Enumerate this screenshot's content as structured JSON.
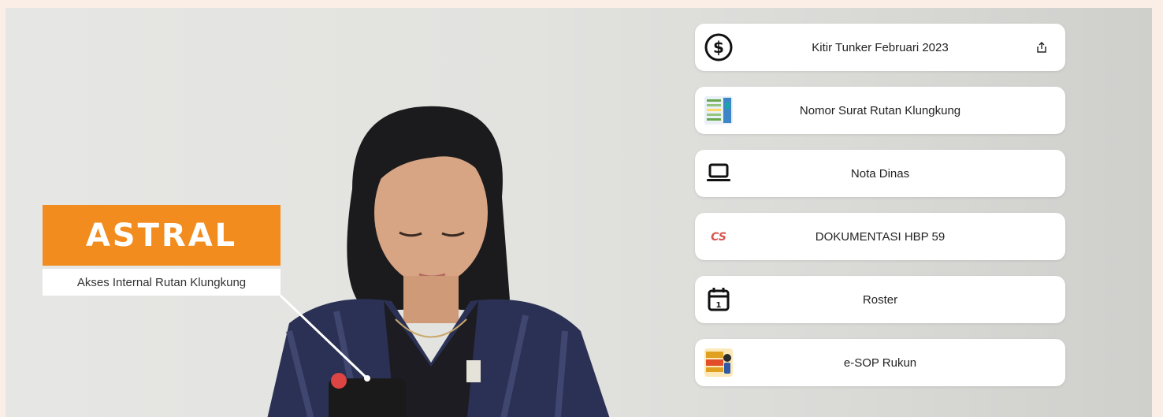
{
  "hero": {
    "brand_title": "ASTRAL",
    "brand_subtitle": "Akses Internal Rutan Klungkung"
  },
  "links": [
    {
      "label": "Kitir Tunker Februari 2023",
      "icon": "dollar-circle-icon",
      "has_share": true
    },
    {
      "label": "Nomor Surat Rutan Klungkung",
      "icon": "spreadsheet-thumbnail-icon"
    },
    {
      "label": "Nota Dinas",
      "icon": "laptop-icon"
    },
    {
      "label": "DOKUMENTASI HBP 59",
      "icon": "hbp-59-logo-icon"
    },
    {
      "label": "Roster",
      "icon": "calendar-icon"
    },
    {
      "label": "e-SOP Rukun",
      "icon": "sop-rukun-logo-icon"
    }
  ],
  "colors": {
    "brand_orange": "#f28c1e",
    "background_peach": "#fbeee6"
  }
}
